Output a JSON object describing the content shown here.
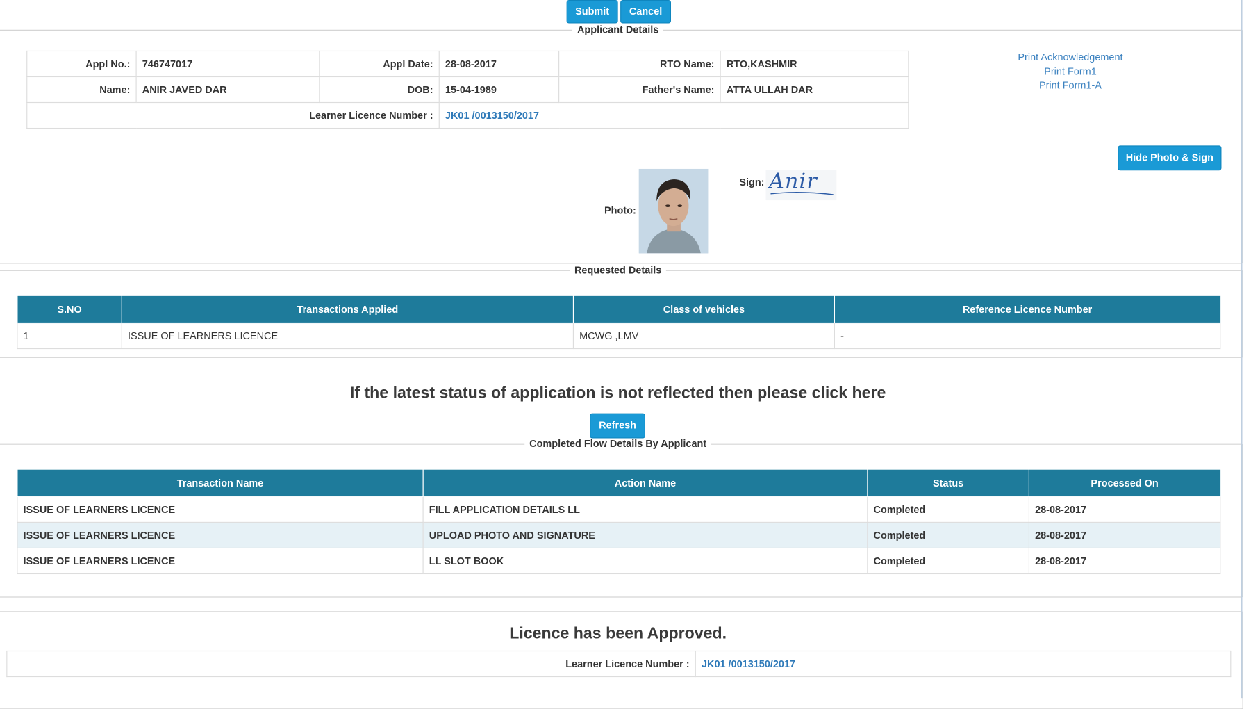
{
  "top_buttons": {
    "submit": "Submit",
    "cancel": "Cancel"
  },
  "applicant": {
    "legend": "Applicant Details",
    "appl_no_label": "Appl No.:",
    "appl_no": "746747017",
    "appl_date_label": "Appl Date:",
    "appl_date": "28-08-2017",
    "rto_label": "RTO Name:",
    "rto": "RTO,KASHMIR",
    "name_label": "Name:",
    "name": "ANIR JAVED DAR",
    "dob_label": "DOB:",
    "dob": "15-04-1989",
    "father_label": "Father's Name:",
    "father": "ATTA ULLAH DAR",
    "ll_label": "Learner Licence Number :",
    "ll_number": "JK01 /0013150/2017",
    "print_links": [
      "Print Acknowledgement",
      "Print Form1",
      "Print Form1-A"
    ],
    "hide_button": "Hide Photo & Sign",
    "photo_label": "Photo:",
    "sign_label": "Sign:",
    "signature_text": "Anir"
  },
  "requested": {
    "legend": "Requested Details",
    "columns": [
      "S.NO",
      "Transactions Applied",
      "Class of vehicles",
      "Reference Licence Number"
    ],
    "rows": [
      [
        "1",
        "ISSUE OF LEARNERS LICENCE",
        "MCWG ,LMV",
        "-"
      ]
    ]
  },
  "status_msg": "If the latest status of application is not reflected then please click here",
  "refresh": "Refresh",
  "completed": {
    "legend": "Completed Flow Details By Applicant",
    "columns": [
      "Transaction Name",
      "Action Name",
      "Status",
      "Processed On"
    ],
    "rows": [
      [
        "ISSUE OF LEARNERS LICENCE",
        "FILL APPLICATION DETAILS LL",
        "Completed",
        "28-08-2017"
      ],
      [
        "ISSUE OF LEARNERS LICENCE",
        "UPLOAD PHOTO AND SIGNATURE",
        "Completed",
        "28-08-2017"
      ],
      [
        "ISSUE OF LEARNERS LICENCE",
        "LL SLOT BOOK",
        "Completed",
        "28-08-2017"
      ]
    ]
  },
  "approval": {
    "message": "Licence has been Approved.",
    "ll_label": "Learner Licence Number :",
    "ll_number": "JK01 /0013150/2017"
  },
  "colors": {
    "button": "#1a9ad6",
    "table_header": "#1e7b9b",
    "link": "#2f7ab9",
    "alt_row": "#e6f1f6"
  }
}
